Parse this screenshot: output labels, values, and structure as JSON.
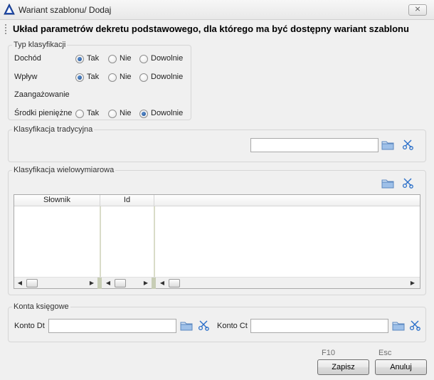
{
  "window": {
    "title": "Wariant szablonu/ Dodaj",
    "close_label": "⨯"
  },
  "header": {
    "text": "Układ parametrów dekretu podstawowego, dla którego ma być dostępny wariant szablonu"
  },
  "classification_type": {
    "title": "Typ klasyfikacji",
    "option_labels": {
      "yes": "Tak",
      "no": "Nie",
      "any": "Dowolnie"
    },
    "rows": [
      {
        "label": "Dochód",
        "selected": "yes"
      },
      {
        "label": "Wpływ",
        "selected": "yes"
      },
      {
        "label": "Zaangażowanie",
        "selected": null
      },
      {
        "label": "Środki pieniężne",
        "selected": "any"
      }
    ]
  },
  "traditional": {
    "title": "Klasyfikacja tradycyjna",
    "value": ""
  },
  "multidimensional": {
    "title": "Klasyfikacja wielowymiarowa",
    "columns": [
      "Słownik",
      "Id"
    ],
    "rows": []
  },
  "accounts": {
    "title": "Konta księgowe",
    "debit_label": "Konto Dt",
    "debit_value": "",
    "credit_label": "Konto Ct",
    "credit_value": ""
  },
  "footer": {
    "save_key": "F10",
    "save_label": "Zapisz",
    "cancel_key": "Esc",
    "cancel_label": "Anuluj"
  },
  "icons": {
    "browse": "folder-icon",
    "clear": "scissors-icon",
    "app": "triangle-app-icon"
  },
  "colors": {
    "accent": "#1f4f91",
    "folder": "#7fa9d8",
    "scissors": "#2a6fc9"
  }
}
